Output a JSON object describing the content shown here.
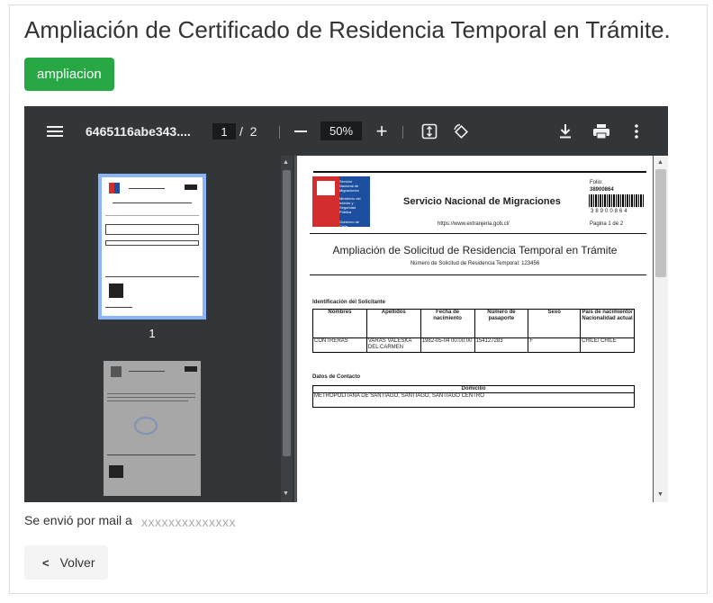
{
  "page": {
    "title": "Ampliación de Certificado de Residencia Temporal en Trámite.",
    "badge_label": "ampliacion"
  },
  "viewer": {
    "filename": "6465116abe343....",
    "current_page": "1",
    "page_separator": "/",
    "total_pages": "2",
    "zoom": "50%",
    "thumbnail_label": "1",
    "icons": [
      "menu-icon",
      "zoom-out-icon",
      "zoom-in-icon",
      "fit-page-icon",
      "rotate-icon",
      "download-icon",
      "print-icon",
      "more-options-icon"
    ]
  },
  "document": {
    "org_name": "Servicio Nacional de Migraciones",
    "logo_text": "Servicio Nacional de Migraciones",
    "logo_sub": "Ministerio del Interior y Seguridad Pública",
    "logo_gov": "Gobierno de Chile",
    "url": "https://www.extranjeria.gob.cl/",
    "folio_label": "Folio:",
    "folio_number": "38900864",
    "barcode_number": "38900864",
    "page_info": "Pagina 1 de 2",
    "heading": "Ampliación de Solicitud de Residencia Temporal en Trámite",
    "subheading": "Número de Solicitud de Residencia Temporal: 123456",
    "section_applicant": "Identificación del Solicitante",
    "applicant_headers": [
      "Nombres",
      "Apellidos",
      "Fecha de nacimiento",
      "Número de pasaporte",
      "Sexo",
      "País de nacimiento/ Nacionalidad actual"
    ],
    "applicant_row": [
      "CONTRERAS",
      "VARAS VALESKA DEL CARMEN",
      "1982-05-04 00:00:00",
      "154127283",
      "F",
      "CHILE/ CHILE"
    ],
    "section_contact": "Datos de Contacto",
    "contact_header": "Domicilio",
    "contact_value": "METROPOLITANA DE SANTIAGO, SANTIAGO, SANTIAGO CENTRO"
  },
  "footer": {
    "mail_label": "Se envió por mail a",
    "mail_address": "xxxxxxxxxxxxxx",
    "back_label": "Volver"
  },
  "colors": {
    "badge": "#28a745",
    "toolbar": "#323639",
    "viewer_bg": "#525659",
    "thumb_border": "#8ab4f8"
  }
}
